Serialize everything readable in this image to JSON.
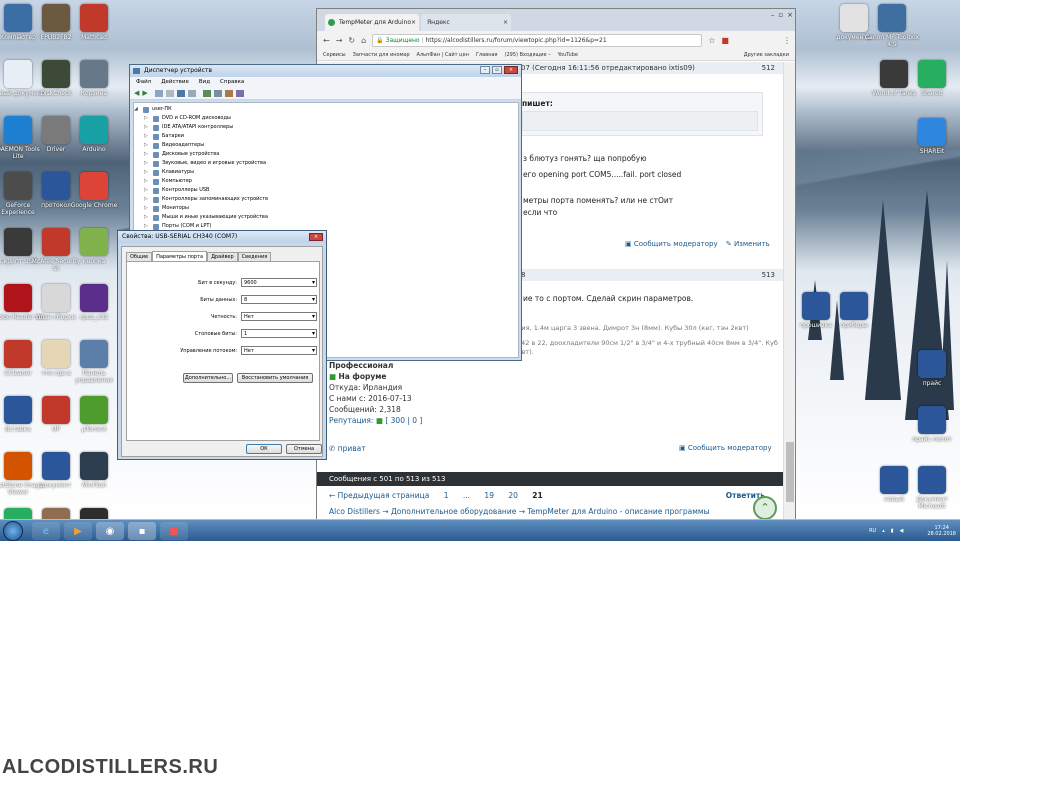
{
  "desktop": {
    "icons_left": [
      {
        "label": "Компьютер",
        "icon": "computer-icon",
        "color": "#3b6ea5"
      },
      {
        "label": "EPUB2FB2",
        "icon": "app-icon",
        "color": "#6b5a3f"
      },
      {
        "label": "Mathcad",
        "icon": "app-icon",
        "color": "#c0392b"
      },
      {
        "label": "Новый документ",
        "icon": "document-icon",
        "color": "#e8eef5"
      },
      {
        "label": "DiskCheck",
        "icon": "app-icon",
        "color": "#3d4a38"
      },
      {
        "label": "Корзина",
        "icon": "recycle-bin-icon",
        "color": "#677988"
      },
      {
        "label": "DAEMON Tools Lite",
        "icon": "app-icon",
        "color": "#1f7fd1"
      },
      {
        "label": "Driver",
        "icon": "app-icon",
        "color": "#7a7a7a"
      },
      {
        "label": "Arduino",
        "icon": "arduino-icon",
        "color": "#17a1a5"
      },
      {
        "label": "GeForce Experience",
        "icon": "app-icon",
        "color": "#4c4c4c"
      },
      {
        "label": "протокол",
        "icon": "word-icon",
        "color": "#2b579a"
      },
      {
        "label": "Google Chrome",
        "icon": "chrome-icon",
        "color": "#db4437"
      },
      {
        "label": "Скрипт USB",
        "icon": "app-icon",
        "color": "#3a3a3a"
      },
      {
        "label": "McAfee Security Sc",
        "icon": "mcafee-icon",
        "color": "#c0392b"
      },
      {
        "label": "кнопка",
        "icon": "app-icon",
        "color": "#7fb24c"
      },
      {
        "label": "Adobe Reader DC",
        "icon": "pdf-icon",
        "color": "#b0131a"
      },
      {
        "label": "план сборки",
        "icon": "document-icon",
        "color": "#d8d8d8"
      },
      {
        "label": "cpuz_x32",
        "icon": "app-icon",
        "color": "#5a2e8a"
      },
      {
        "label": "CCleaner",
        "icon": "app-icon",
        "color": "#c0392b"
      },
      {
        "label": "что-где-в",
        "icon": "document-icon",
        "color": "#e5d7b5"
      },
      {
        "label": "Панель управления",
        "icon": "control-panel-icon",
        "color": "#5b7fa8"
      },
      {
        "label": "Вставка",
        "icon": "word-icon",
        "color": "#2b579a"
      },
      {
        "label": "UP",
        "icon": "app-icon",
        "color": "#c0392b"
      },
      {
        "label": "µTorrent",
        "icon": "utorrent-icon",
        "color": "#4e9c2e"
      },
      {
        "label": "FastStone Image Viewer",
        "icon": "app-icon",
        "color": "#d35400"
      },
      {
        "label": "документ",
        "icon": "word-icon",
        "color": "#2b579a"
      },
      {
        "label": "MiniTool",
        "icon": "app-icon",
        "color": "#2c3e50"
      },
      {
        "label": "Reelab",
        "icon": "app-icon",
        "color": "#27ae60"
      },
      {
        "label": "OS",
        "icon": "app-icon",
        "color": "#8e6e4e"
      },
      {
        "label": "Sheet",
        "icon": "app-icon",
        "color": "#2d2d2d"
      }
    ],
    "icons_right": [
      {
        "label": "документы",
        "icon": "document-icon",
        "color": "#e2e2e2"
      },
      {
        "label": "Canon MF Toolbox 4.9",
        "icon": "printer-icon",
        "color": "#3f6fa0"
      },
      {
        "label": "World of Tanks",
        "icon": "game-icon",
        "color": "#3a3a3a"
      },
      {
        "label": "Shareit",
        "icon": "app-icon",
        "color": "#27ae60"
      },
      {
        "label": "SHAREit",
        "icon": "shareit-icon",
        "color": "#2e86de"
      },
      {
        "label": "прошивка",
        "icon": "word-icon",
        "color": "#2b579a"
      },
      {
        "label": "приборы",
        "icon": "word-icon",
        "color": "#2b579a"
      },
      {
        "label": "прайс",
        "icon": "word-icon",
        "color": "#2b579a"
      },
      {
        "label": "прайс-пилот",
        "icon": "word-icon",
        "color": "#2b579a"
      },
      {
        "label": "новый",
        "icon": "word-icon",
        "color": "#2b579a"
      },
      {
        "label": "Документ Microsoft",
        "icon": "word-icon",
        "color": "#2b579a"
      }
    ],
    "watermark": "ALCODISTILLERS.RU"
  },
  "browser": {
    "tabs": [
      {
        "label": "TempMeter для Arduino"
      },
      {
        "label": "Яндекс"
      }
    ],
    "secure_label": "Защищено",
    "url": "https://alcodistillers.ru/forum/viewtopic.php?id=1126&p=21",
    "bookmarks": [
      "Сервисы",
      "Запчасти для иномар",
      "АльпФан | Сайт цен",
      "Главная",
      "(295) Входящие –",
      "YouTube",
      "Другие закладки"
    ],
    "posts": [
      {
        "header": "07 (Сегодня 16:11:56 отредактировано ixtis09)",
        "num": "512",
        "quote_title": "пишет:",
        "lines": [
          "з блютуз гонять? ща попробую",
          "его opening port COM5.....fail. port closed",
          "метры порта поменять? или не стОит",
          "если что"
        ],
        "actions": [
          "Сообщить модератору",
          "Изменить"
        ]
      },
      {
        "header": "8",
        "num": "513",
        "lines": [
          "ие то с портом. Сделай скрин параметров."
        ],
        "signature": [
          "ция, 1.4м царга 3 звена. Димрот 3н (8мм). Кубы 30л (кег, тэн 2квт)",
          "базе РК, поворот 42 в 22, доохладители 90см 1/2\" в 3/4\" и 4-х трубный 40см 8мм в 3/4\". Куб 36л (индукция 3квт)."
        ],
        "author": {
          "rank": "Профессионал",
          "status": "На форуме",
          "from": "Откуда: Ирландия",
          "since": "С нами с: 2016-07-13",
          "posts": "Сообщений: 2,318",
          "rep_label": "Репутация:",
          "rep_plus": "300",
          "rep_minus": "0"
        },
        "private": "приват",
        "report": "Сообщить модератору"
      }
    ],
    "pagination_info": "Сообщения с 501 по 513 из 513",
    "prev_page": "Предыдущая страница",
    "pages": [
      "1",
      "...",
      "19",
      "20",
      "21"
    ],
    "reply": "Ответить",
    "breadcrumb": [
      "Alco Distillers",
      "Дополнительное оборудование",
      "TempMeter для Arduino - описание программы"
    ]
  },
  "devmgr": {
    "title": "Диспетчер устройств",
    "menu": [
      "Файл",
      "Действие",
      "Вид",
      "Справка"
    ],
    "root": "user-ПК",
    "items": [
      "DVD и CD-ROM дисководы",
      "IDE ATA/ATAPI контроллеры",
      "Батареи",
      "Видеоадаптеры",
      "Дисковые устройства",
      "Звуковые, видео и игровые устройства",
      "Клавиатуры",
      "Компьютер",
      "Контроллеры USB",
      "Контроллеры запоминающих устройств",
      "Мониторы",
      "Мыши и иные указывающие устройства",
      "Порты (COM и LPT)"
    ]
  },
  "props": {
    "title": "Свойства: USB-SERIAL CH340 (COM7)",
    "tabs": [
      "Общие",
      "Параметры порта",
      "Драйвер",
      "Сведения"
    ],
    "active_tab": "Параметры порта",
    "fields": [
      {
        "label": "Бит в секунду:",
        "value": "9600"
      },
      {
        "label": "Биты данных:",
        "value": "8"
      },
      {
        "label": "Четность:",
        "value": "Нет"
      },
      {
        "label": "Стоповые биты:",
        "value": "1"
      },
      {
        "label": "Управление потоком:",
        "value": "Нет"
      }
    ],
    "advanced": "Дополнительно...",
    "restore": "Восстановить умолчания",
    "ok": "ОК",
    "cancel": "Отмена"
  },
  "taskbar": {
    "lang": "RU",
    "time": "17:24",
    "date": "28.02.2018"
  }
}
